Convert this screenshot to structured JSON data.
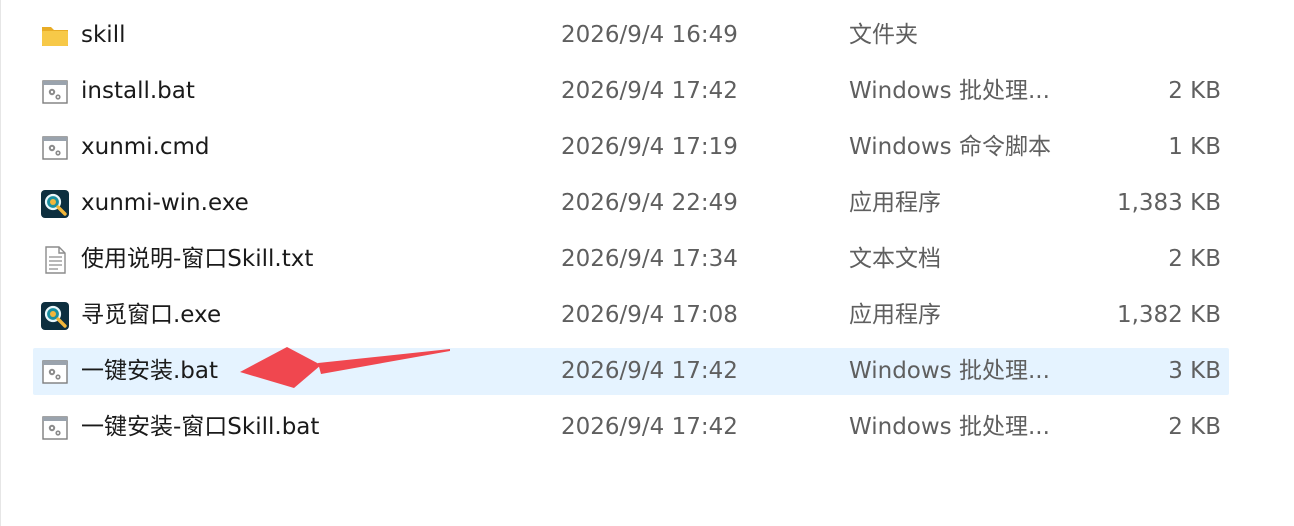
{
  "files": [
    {
      "name": "skill",
      "date": "2026/9/4 16:49",
      "type": "文件夹",
      "size": "",
      "icon": "folder-icon"
    },
    {
      "name": "install.bat",
      "date": "2026/9/4 17:42",
      "type": "Windows 批处理...",
      "size": "2 KB",
      "icon": "batch-file-icon"
    },
    {
      "name": "xunmi.cmd",
      "date": "2026/9/4 17:19",
      "type": "Windows 命令脚本",
      "size": "1 KB",
      "icon": "batch-file-icon"
    },
    {
      "name": "xunmi-win.exe",
      "date": "2026/9/4 22:49",
      "type": "应用程序",
      "size": "1,383 KB",
      "icon": "search-app-icon"
    },
    {
      "name": "使用说明-窗口Skill.txt",
      "date": "2026/9/4 17:34",
      "type": "文本文档",
      "size": "2 KB",
      "icon": "text-file-icon"
    },
    {
      "name": "寻觅窗口.exe",
      "date": "2026/9/4 17:08",
      "type": "应用程序",
      "size": "1,382 KB",
      "icon": "search-app-icon"
    },
    {
      "name": "一键安装.bat",
      "date": "2026/9/4 17:42",
      "type": "Windows 批处理...",
      "size": "3 KB",
      "icon": "batch-file-icon",
      "selected": true
    },
    {
      "name": "一键安装-窗口Skill.bat",
      "date": "2026/9/4 17:42",
      "type": "Windows 批处理...",
      "size": "2 KB",
      "icon": "batch-file-icon"
    }
  ],
  "colors": {
    "selection": "#e5f3ff",
    "annotation_arrow": "#f0474f",
    "folder": "#f5c242",
    "secondary_text": "#5f5f5f"
  }
}
